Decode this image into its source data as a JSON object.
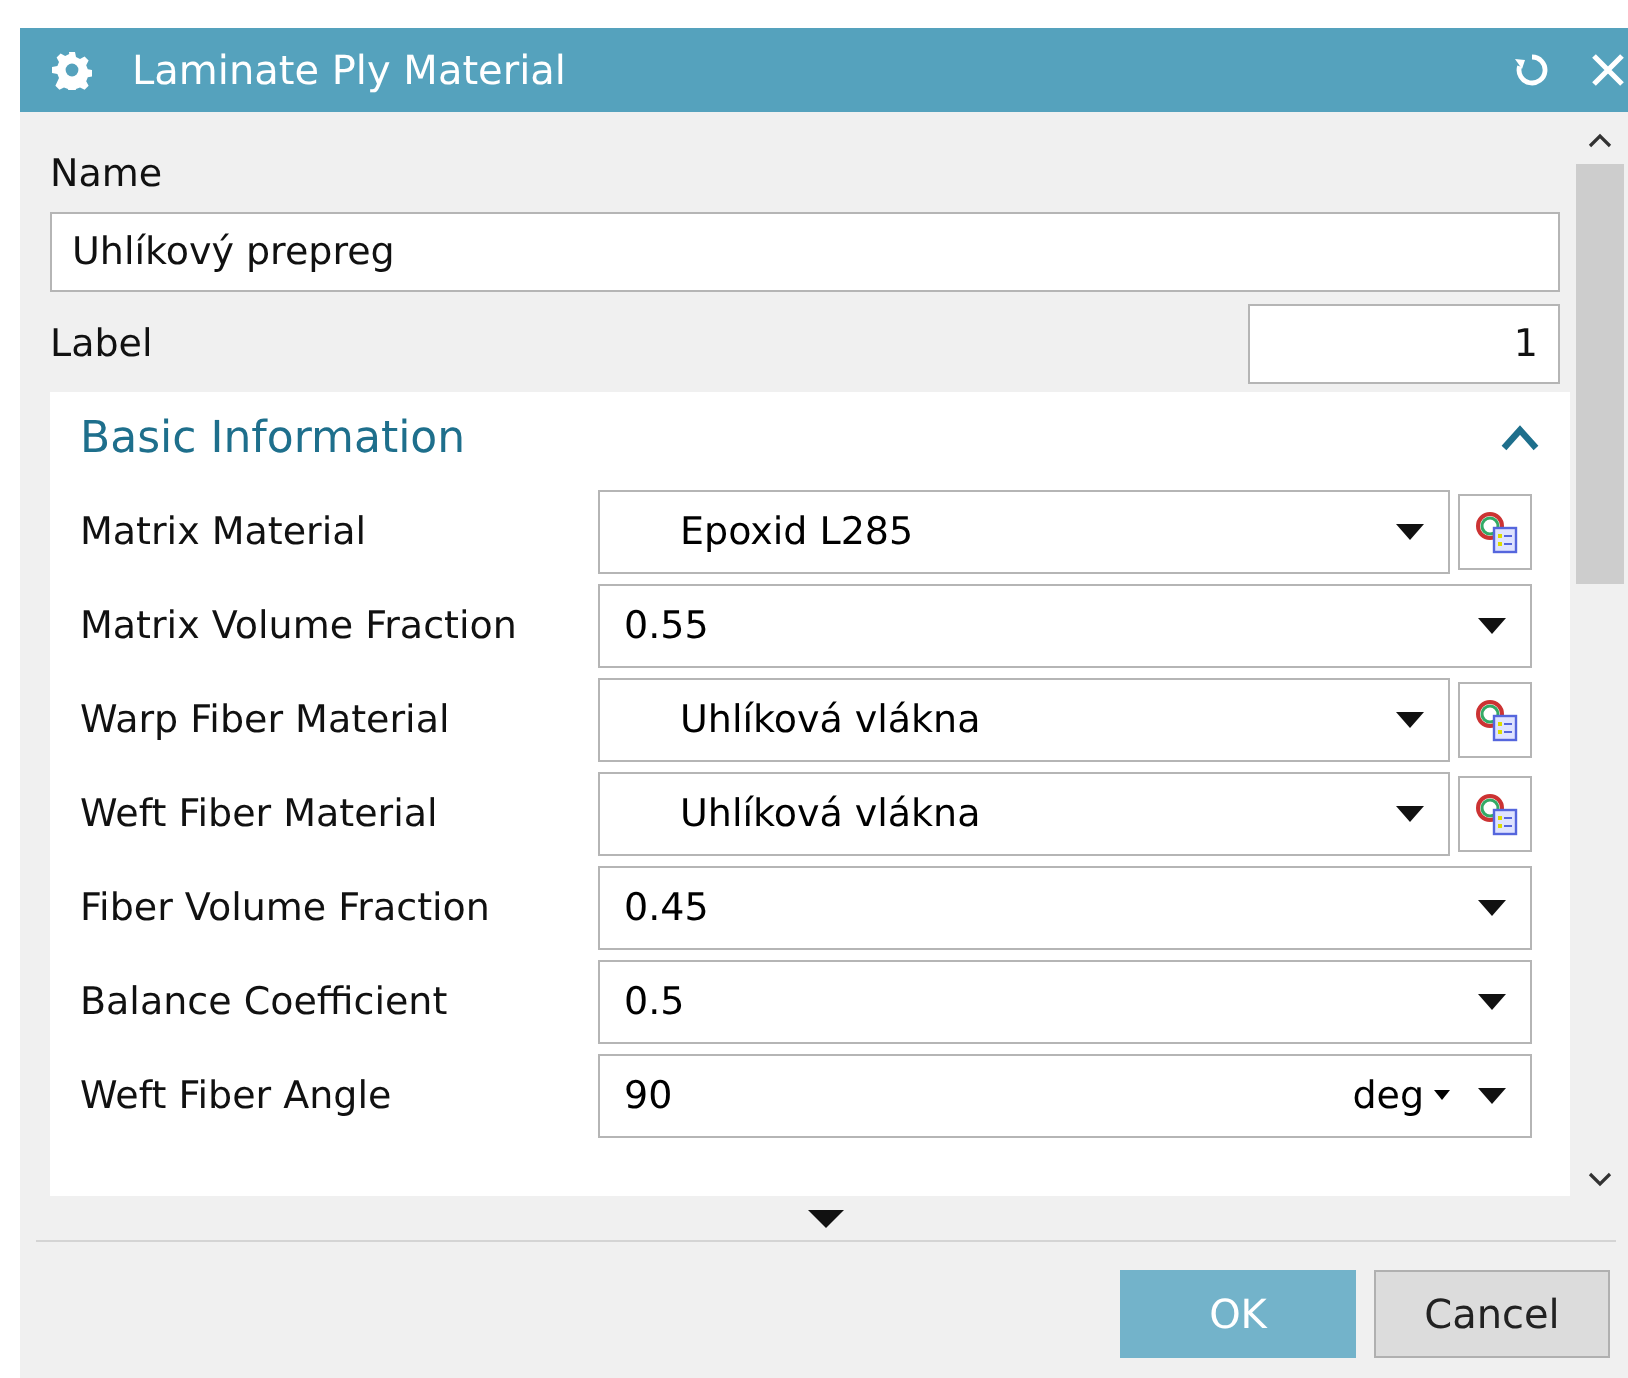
{
  "window": {
    "title": "Laminate Ply Material"
  },
  "name": {
    "label": "Name",
    "value": "Uhlíkový prepreg"
  },
  "label_field": {
    "label": "Label",
    "value": "1"
  },
  "section": {
    "title": "Basic Information",
    "expanded": true,
    "rows": [
      {
        "kind": "select-button",
        "label": "Matrix Material",
        "value": "Epoxid L285"
      },
      {
        "kind": "select",
        "label": "Matrix Volume Fraction",
        "value": "0.55"
      },
      {
        "kind": "select-button",
        "label": "Warp Fiber Material",
        "value": "Uhlíková vlákna"
      },
      {
        "kind": "select-button",
        "label": "Weft Fiber Material",
        "value": "Uhlíková vlákna"
      },
      {
        "kind": "select",
        "label": "Fiber Volume Fraction",
        "value": "0.45"
      },
      {
        "kind": "select",
        "label": "Balance Coefficient",
        "value": "0.5"
      },
      {
        "kind": "select-unit",
        "label": "Weft Fiber Angle",
        "value": "90",
        "unit": "deg"
      }
    ]
  },
  "buttons": [
    {
      "label": "OK",
      "kind": "primary"
    },
    {
      "label": "Cancel",
      "kind": "secondary"
    }
  ]
}
